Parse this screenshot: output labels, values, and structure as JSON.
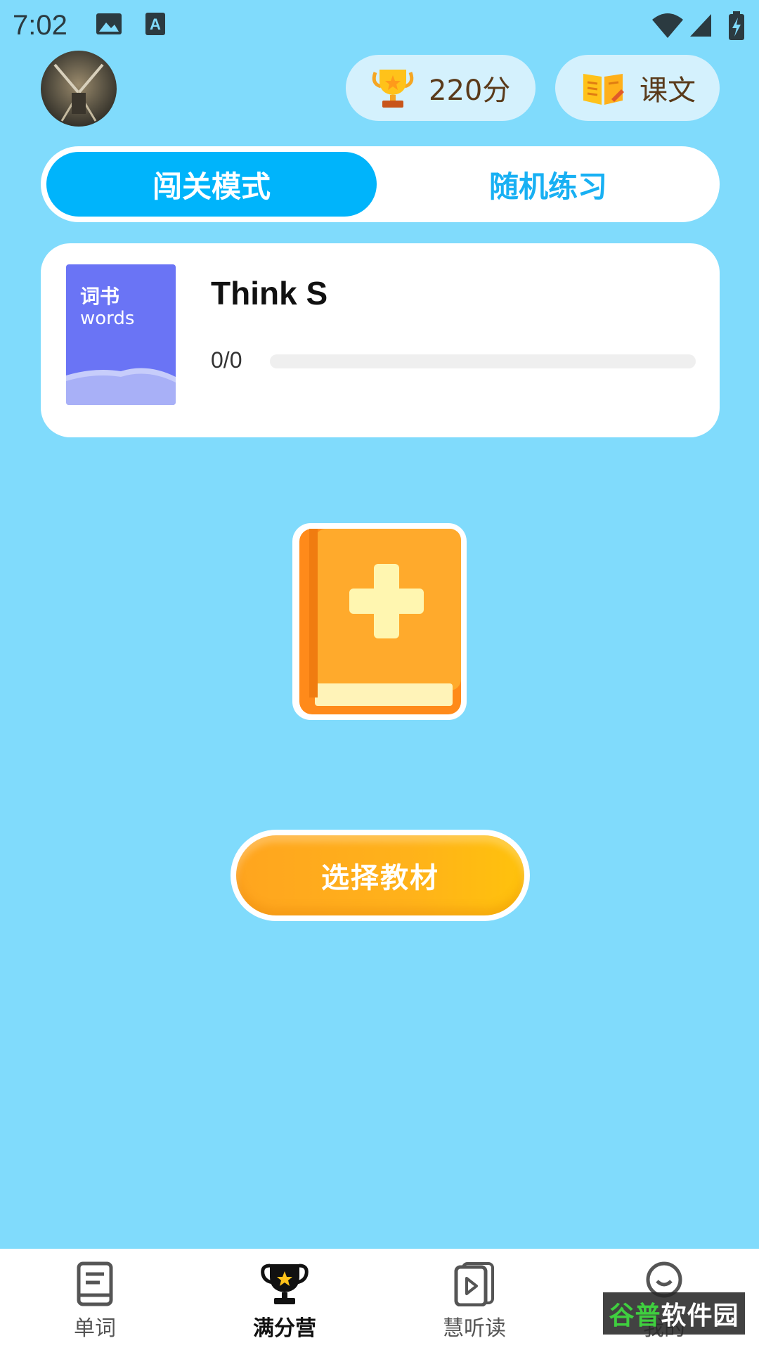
{
  "status_bar": {
    "time": "7:02"
  },
  "header": {
    "score_label": "220分",
    "text_label": "课文"
  },
  "modes": {
    "active": "闯关模式",
    "inactive": "随机练习"
  },
  "book": {
    "cover_title": "词书",
    "cover_sub": "words",
    "title": "Think S",
    "progress_text": "0/0",
    "progress": 0
  },
  "select_button_label": "选择教材",
  "nav": {
    "items": [
      {
        "label": "单词",
        "icon": "book-icon"
      },
      {
        "label": "满分营",
        "icon": "trophy-icon"
      },
      {
        "label": "慧听读",
        "icon": "play-card-icon"
      },
      {
        "label": "我的",
        "icon": "smile-icon"
      }
    ]
  },
  "watermark": {
    "part1": "谷普",
    "part2": "软件园"
  },
  "colors": {
    "background": "#80dbfc",
    "accent": "#00b4fb",
    "button": "#ffb21a"
  }
}
